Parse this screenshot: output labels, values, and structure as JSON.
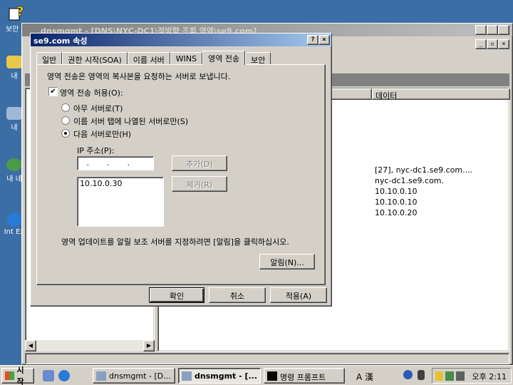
{
  "desktop": {
    "icons": [
      {
        "label": "보안",
        "name": "security-desktop-icon"
      },
      {
        "label": "내",
        "name": "my-documents-desktop-icon"
      },
      {
        "label": "내",
        "name": "my-computer-desktop-icon"
      },
      {
        "label": "내 네",
        "name": "my-network-desktop-icon"
      },
      {
        "label": "Int Ex",
        "name": "internet-explorer-desktop-icon"
      }
    ]
  },
  "mmc": {
    "title": "dnsmgmt - [DNS\\NYC-DC1\\정방향 조회 영역\\se9.com]",
    "column_data_header": "데이터",
    "data_rows": [
      "[27], nyc-dc1.se9.com....",
      "nyc-dc1.se9.com.",
      "10.10.0.10",
      "10.10.0.10",
      "10.10.0.20"
    ]
  },
  "dialog": {
    "title": "se9.com 속성",
    "help_btn": "?",
    "close_btn": "×",
    "tabs": [
      "일반",
      "권한 시작(SOA)",
      "이름 서버",
      "WINS",
      "영역 전송",
      "보안"
    ],
    "active_tab_index": 4,
    "intro": "영역 전송은 영역의 복사본을 요청하는 서버로 보냅니다.",
    "allow_transfer_label": "영역 전송 허용(O):",
    "allow_transfer_checked": true,
    "radio_any": "아무 서버로(T)",
    "radio_ns_tab": "이름 서버 탭에 나열된 서버로만(S)",
    "radio_following": "다음 서버로만(H)",
    "ip_label": "IP 주소(P):",
    "ip_input_value": " .  .  . ",
    "add_btn": "추가(D)",
    "remove_btn": "제거(R)",
    "ip_list": [
      "10.10.0.30"
    ],
    "notify_text": "영역 업데이트를 알릴 보조 서버를 지정하려면 [알림]을 클릭하십시오.",
    "notify_btn": "알림(N)...",
    "ok_btn": "확인",
    "cancel_btn": "취소",
    "apply_btn": "적용(A)"
  },
  "taskbar": {
    "start_label": "시작",
    "tasks": [
      {
        "label": "dnsmgmt - [D...",
        "pressed": false
      },
      {
        "label": "dnsmgmt - [...",
        "pressed": true
      },
      {
        "label": "명령 프롬프트",
        "pressed": false
      }
    ],
    "ime_label": "A 漢",
    "clock": "오후 2:11"
  }
}
